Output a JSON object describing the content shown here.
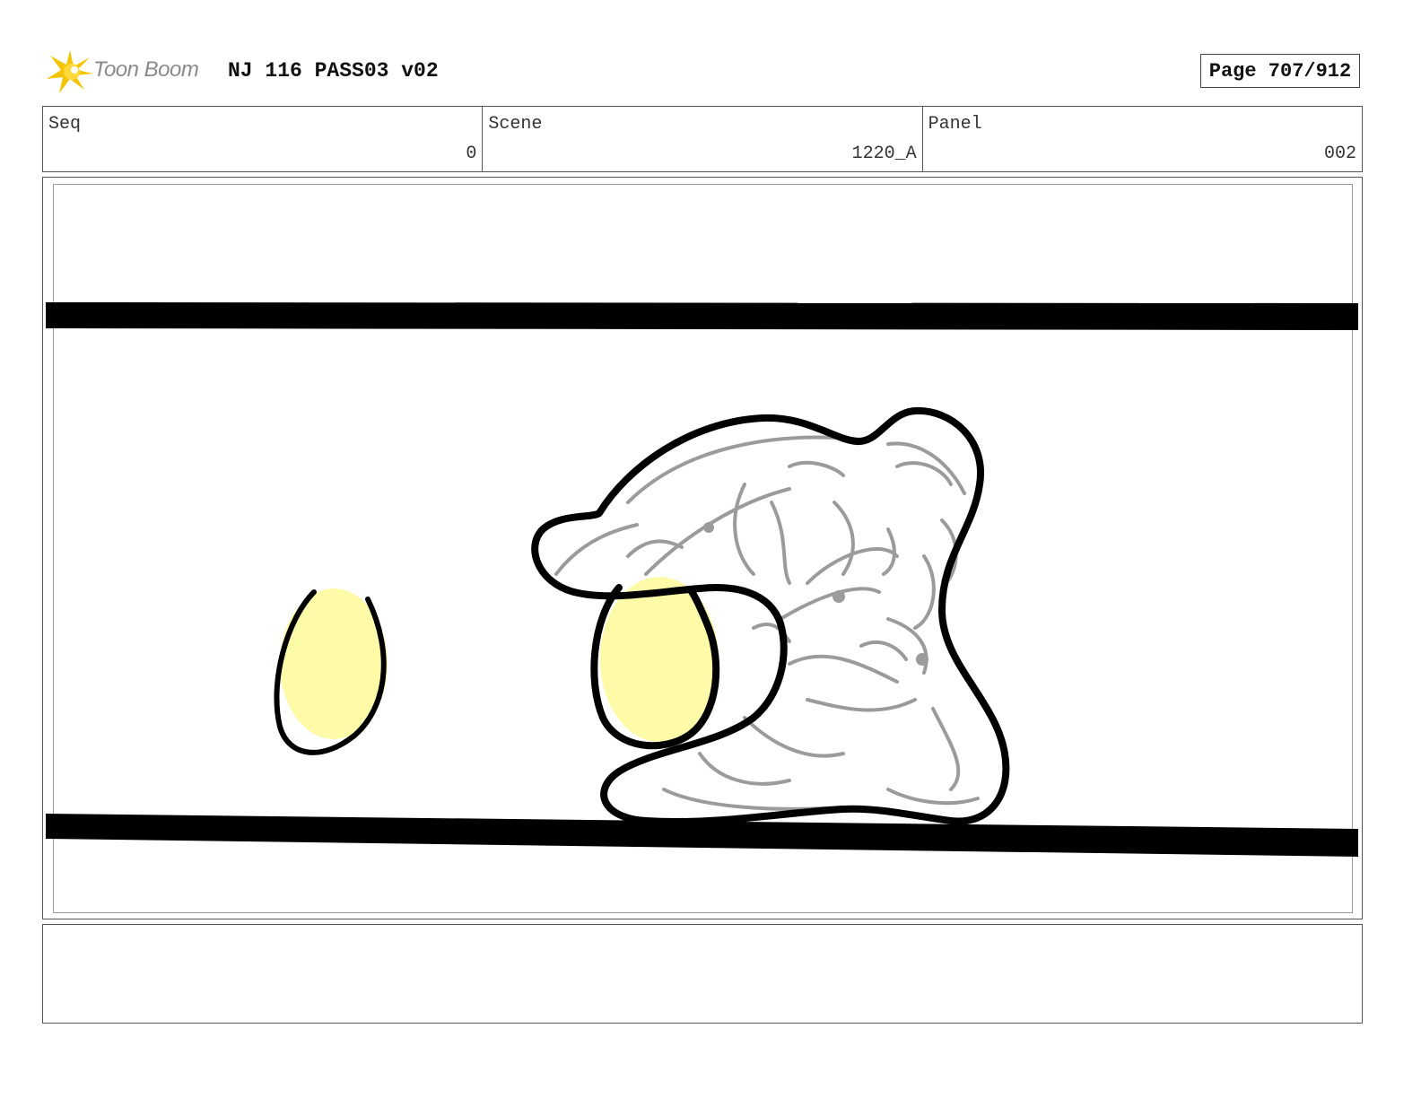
{
  "header": {
    "logo_text": "Toon Boom",
    "title": "NJ 116 PASS03 v02",
    "page": "Page 707/912"
  },
  "info": {
    "seq_label": "Seq",
    "seq_value": "0",
    "scene_label": "Scene",
    "scene_value": "1220_A",
    "panel_label": "Panel",
    "panel_value": "002"
  },
  "colors": {
    "logo_star": "#f5c400",
    "highlight": "#fdfaa8",
    "ink": "#000000",
    "rough": "#9b9b9b"
  },
  "notes": {
    "text": ""
  }
}
